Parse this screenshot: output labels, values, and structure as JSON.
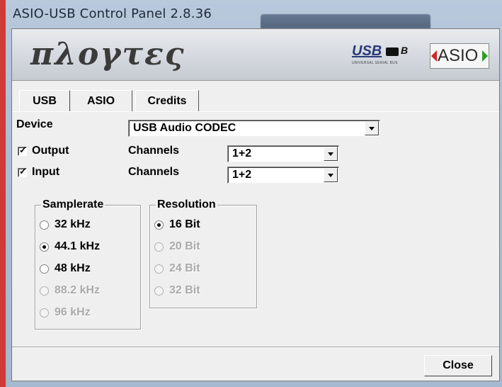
{
  "window": {
    "title": "ASIO-USB Control Panel 2.8.36"
  },
  "banner": {
    "brand": "πλογτες",
    "usb_logo_text": "USB",
    "usb_logo_b": "B",
    "usb_logo_sub": "UNIVERSAL SERIAL BUS",
    "asio_logo_text": "ASIO"
  },
  "tabs": [
    {
      "label": "USB",
      "active": true
    },
    {
      "label": "ASIO",
      "active": false
    },
    {
      "label": "Credits",
      "active": false
    }
  ],
  "device": {
    "label": "Device",
    "value": "USB Audio CODEC"
  },
  "output": {
    "checkbox_label": "Output",
    "checked": true,
    "channels_label": "Channels",
    "channels_value": "1+2"
  },
  "input": {
    "checkbox_label": "Input",
    "checked": true,
    "channels_label": "Channels",
    "channels_value": "1+2"
  },
  "samplerate": {
    "title": "Samplerate",
    "options": [
      {
        "label": "32 kHz",
        "selected": false,
        "enabled": true
      },
      {
        "label": "44.1 kHz",
        "selected": true,
        "enabled": true
      },
      {
        "label": "48 kHz",
        "selected": false,
        "enabled": true
      },
      {
        "label": "88.2 kHz",
        "selected": false,
        "enabled": false
      },
      {
        "label": "96 kHz",
        "selected": false,
        "enabled": false
      }
    ]
  },
  "resolution": {
    "title": "Resolution",
    "options": [
      {
        "label": "16 Bit",
        "selected": true,
        "enabled": true
      },
      {
        "label": "20 Bit",
        "selected": false,
        "enabled": false
      },
      {
        "label": "24 Bit",
        "selected": false,
        "enabled": false
      },
      {
        "label": "32 Bit",
        "selected": false,
        "enabled": false
      }
    ]
  },
  "buttons": {
    "close": "Close"
  },
  "colors": {
    "window_frame": "#a9bdd4",
    "dialog_bg": "#efefef",
    "accent_red": "#cf3b36",
    "disabled_text": "#a9a9a9"
  }
}
